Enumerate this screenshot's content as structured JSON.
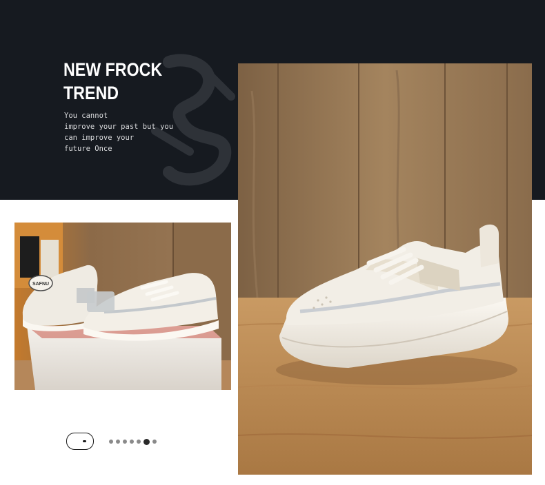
{
  "banner": {
    "headline_line1": "NEW FROCK",
    "headline_line2": "TREND",
    "tagline_lines": [
      "You cannot",
      "improve your past but you",
      "can improve your",
      "future Once"
    ]
  },
  "thumbnail": {
    "badge_text": "SAFNU"
  },
  "carousel": {
    "dot_count": 7,
    "active_index": 5
  },
  "colors": {
    "banner_bg": "#161a20",
    "wood_wall": "#9b7a55",
    "wood_table": "#b8874f",
    "sneaker": "#eeeae2",
    "page_bg": "#ffffff"
  },
  "icons": {
    "toggle": "toggle-icon",
    "pager": "pager-dots-icon"
  }
}
